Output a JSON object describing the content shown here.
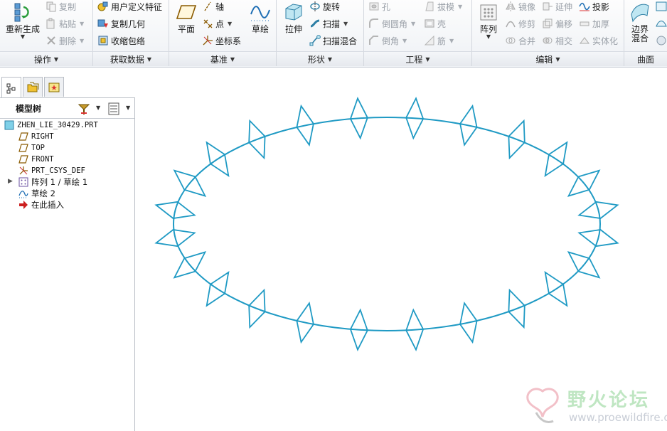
{
  "ribbon": {
    "groups": {
      "operations": {
        "label": "操作",
        "regenerate": "重新生成",
        "copy": "复制",
        "paste": "粘贴",
        "delete": "删除"
      },
      "get_data": {
        "label": "获取数据",
        "udf": "用户定义特征",
        "copy_geometry": "复制几何",
        "shrinkwrap": "收缩包络"
      },
      "datum": {
        "label": "基准",
        "plane": "平面",
        "axis": "轴",
        "point": "点",
        "csys": "坐标系",
        "sketch": "草绘"
      },
      "shapes": {
        "label": "形状",
        "extrude": "拉伸",
        "revolve": "旋转",
        "sweep": "扫描",
        "swept_blend": "扫描混合"
      },
      "engineering": {
        "label": "工程",
        "hole": "孔",
        "draft": "拔模",
        "round": "倒圆角",
        "shell": "壳",
        "chamfer": "倒角",
        "rib": "筋"
      },
      "editing": {
        "label": "编辑",
        "pattern": "阵列",
        "mirror": "镜像",
        "extend": "延伸",
        "project": "投影",
        "trim": "修剪",
        "offset": "偏移",
        "thicken": "加厚",
        "merge": "合并",
        "intersect": "相交",
        "solidify": "实体化"
      },
      "surfaces": {
        "label": "曲面",
        "boundary_blend": "边界\n混合"
      }
    }
  },
  "model_tree": {
    "title": "模型树",
    "items": [
      {
        "label": "ZHEN_LIE_30429.PRT",
        "icon": "part-icon"
      },
      {
        "label": "RIGHT",
        "icon": "datum-plane-icon"
      },
      {
        "label": "TOP",
        "icon": "datum-plane-icon"
      },
      {
        "label": "FRONT",
        "icon": "datum-plane-icon"
      },
      {
        "label": "PRT_CSYS_DEF",
        "icon": "csys-icon"
      },
      {
        "label": "阵列 1 / 草绘 1",
        "icon": "pattern-icon"
      },
      {
        "label": "草绘 2",
        "icon": "sketch-icon"
      },
      {
        "label": "在此插入",
        "icon": "insert-arrow-icon"
      }
    ]
  },
  "graphics": {
    "pattern_count": 24,
    "curve_color": "#1f9ac4"
  },
  "watermark": {
    "title": "野火论坛",
    "url": "www.proewildfire.cn"
  },
  "colors": {
    "accent": "#1f9ac4",
    "ribbon_bg": "#eef1f5",
    "disabled_text": "#9aa0a8"
  }
}
